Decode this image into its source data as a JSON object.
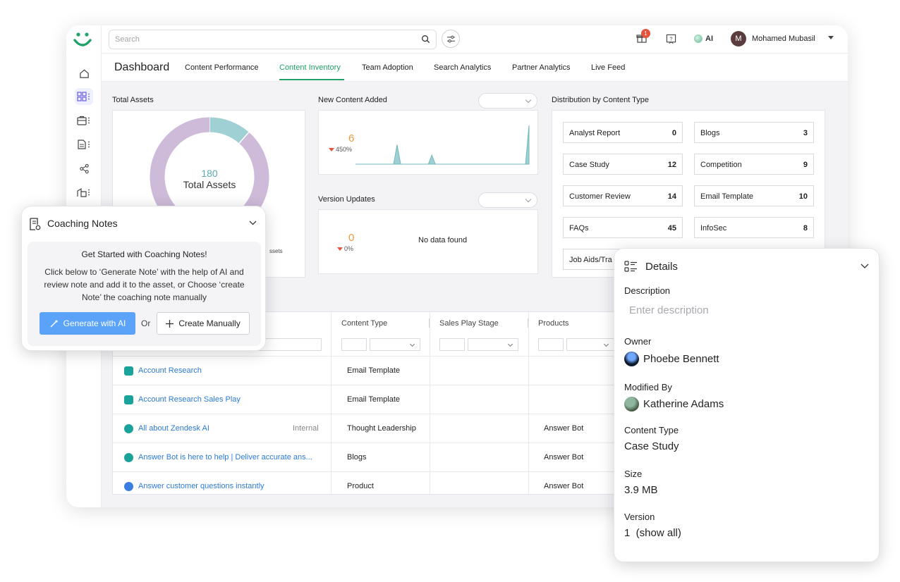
{
  "topbar": {
    "search_placeholder": "Search",
    "notification_count": "1",
    "ai_label": "AI",
    "user_initial": "M",
    "user_name": "Mohamed Mubasil"
  },
  "nav": {
    "title": "Dashboard",
    "tabs": [
      {
        "label": "Content Performance",
        "active": false
      },
      {
        "label": "Content Inventory",
        "active": true
      },
      {
        "label": "Team Adoption",
        "active": false
      },
      {
        "label": "Search Analytics",
        "active": false
      },
      {
        "label": "Partner Analytics",
        "active": false
      },
      {
        "label": "Live Feed",
        "active": false
      }
    ]
  },
  "colors": {
    "accent_green": "#20a268",
    "donut_teal": "#9fd0d3",
    "donut_purple": "#cdbbd9",
    "link_blue": "#2b7bd4",
    "primary_button": "#5aa3f8",
    "metric_orange": "#e89a3c"
  },
  "total_assets": {
    "title": "Total Assets",
    "count": "180",
    "label": "Total Assets",
    "legend_fragment": "ssets",
    "chart_data": {
      "type": "pie",
      "segments": [
        {
          "name": "",
          "fraction": 0.115,
          "color": "#9fd0d3"
        },
        {
          "name": "",
          "fraction": 0.885,
          "color": "#cdbbd9"
        }
      ]
    }
  },
  "new_content": {
    "title": "New Content Added",
    "value": "6",
    "change": "450%",
    "chart_data": {
      "type": "area",
      "values": [
        0,
        0,
        0,
        0,
        0,
        0,
        0,
        0,
        0,
        0,
        0,
        0,
        3,
        0,
        0,
        0,
        0,
        0,
        0,
        0,
        0,
        0,
        1.4,
        0,
        0,
        0,
        0,
        0,
        0,
        0,
        0,
        0,
        0,
        0,
        0,
        0,
        0,
        0,
        0,
        0,
        0,
        0,
        0,
        0,
        0,
        0,
        0,
        0,
        0,
        0,
        6
      ],
      "color": "#9fd0d3"
    }
  },
  "version_updates": {
    "title": "Version Updates",
    "value": "0",
    "change": "0%",
    "empty_text": "No data found"
  },
  "distribution": {
    "title": "Distribution by Content Type",
    "items": [
      {
        "label": "Analyst Report",
        "value": "0"
      },
      {
        "label": "Blogs",
        "value": "3"
      },
      {
        "label": "Case Study",
        "value": "12"
      },
      {
        "label": "Competition",
        "value": "9"
      },
      {
        "label": "Customer Review",
        "value": "14"
      },
      {
        "label": "Email Template",
        "value": "10"
      },
      {
        "label": "FAQs",
        "value": "45"
      },
      {
        "label": "InfoSec",
        "value": "8"
      },
      {
        "label": "Job Aids/Tra",
        "value": ""
      }
    ]
  },
  "table": {
    "headers": [
      "Content Type",
      "Sales Play Stage",
      "Products"
    ],
    "rows": [
      {
        "icon": "layers-icon",
        "title": "Account Research",
        "tag": "",
        "type": "Email Template",
        "stage": "",
        "product": ""
      },
      {
        "icon": "layers-icon",
        "title": "Account Research Sales Play",
        "tag": "",
        "type": "Email Template",
        "stage": "",
        "product": ""
      },
      {
        "icon": "globe-icon",
        "title": "All about Zendesk AI",
        "tag": "Internal",
        "type": "Thought Leadership",
        "stage": "",
        "product": "Answer Bot"
      },
      {
        "icon": "globe-icon",
        "title": "Answer Bot is here to help | Deliver accurate ans...",
        "tag": "",
        "type": "Blogs",
        "stage": "",
        "product": "Answer Bot"
      },
      {
        "icon": "play-icon",
        "title": "Answer customer questions instantly",
        "tag": "",
        "type": "Product",
        "stage": "",
        "product": "Answer Bot"
      }
    ]
  },
  "coaching": {
    "title": "Coaching Notes",
    "heading": "Get Started with Coaching Notes!",
    "body": "Click below to ‘Generate Note’ with the help of AI and review note and add it to the asset, or Choose ‘create Note’ the coaching note manually",
    "generate_label": "Generate with AI",
    "or_label": "Or",
    "manual_label": "Create Manually"
  },
  "details": {
    "title": "Details",
    "description_label": "Description",
    "description_placeholder": "Enter description",
    "owner_label": "Owner",
    "owner": "Phoebe Bennett",
    "modified_label": "Modified By",
    "modified_by": "Katherine Adams",
    "type_label": "Content Type",
    "type": "Case Study",
    "size_label": "Size",
    "size": "3.9 MB",
    "version_label": "Version",
    "version": "1  (show all)"
  }
}
